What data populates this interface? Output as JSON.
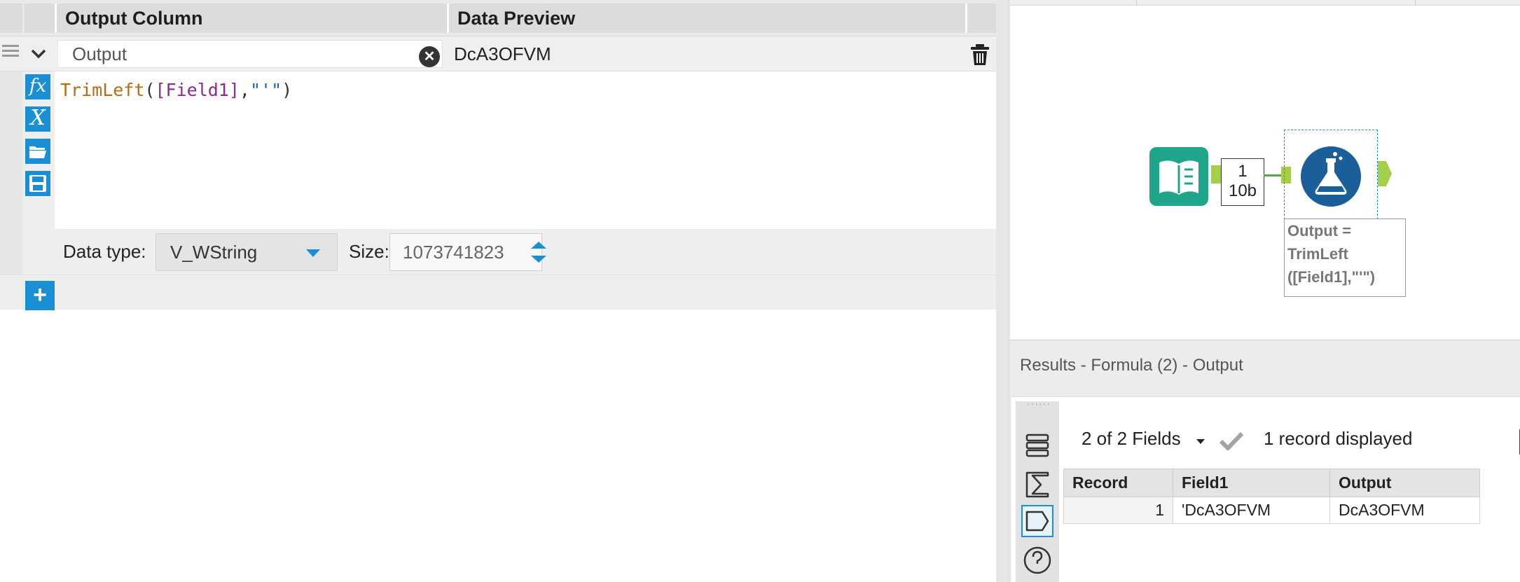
{
  "formula_config": {
    "headers": {
      "output_column": "Output Column",
      "data_preview": "Data Preview"
    },
    "field": {
      "name": "Output",
      "preview": "DcA3OFVM"
    },
    "expression": {
      "function": "TrimLeft",
      "open_paren": "(",
      "field_ref": "[Field1]",
      "comma": ",",
      "string_arg": "\"'\"",
      "close_paren": ")"
    },
    "data_type_label": "Data type:",
    "data_type_value": "V_WString",
    "size_label": "Size:",
    "size_value": "1073741823",
    "add_label": "+"
  },
  "canvas": {
    "record_count": "1",
    "record_size": "10b",
    "annotation_lines": [
      "Output =",
      "TrimLeft",
      "([Field1],\"'\")"
    ]
  },
  "results": {
    "title": "Results - Formula (2) - Output",
    "fields_selector": "2 of 2 Fields",
    "records_displayed": "1 record displayed",
    "columns": [
      "Record",
      "Field1",
      "Output"
    ],
    "rows": [
      {
        "record": "1",
        "field1": "'DcA3OFVM",
        "output": "DcA3OFVM"
      }
    ]
  },
  "colors": {
    "accent": "#1b8fd4",
    "input_tool": "#1fa58a",
    "anchor": "#a5cf48",
    "formula_tool": "#1a5e9a"
  },
  "icons": [
    "drag-handle-icon",
    "chevron-down-icon",
    "clear-icon",
    "trash-icon",
    "function-icon",
    "variable-icon",
    "open-folder-icon",
    "save-icon",
    "plus-icon",
    "input-data-tool-icon",
    "formula-tool-icon",
    "checkmark-icon",
    "table-view-icon",
    "summary-icon",
    "tag-icon",
    "help-icon"
  ]
}
